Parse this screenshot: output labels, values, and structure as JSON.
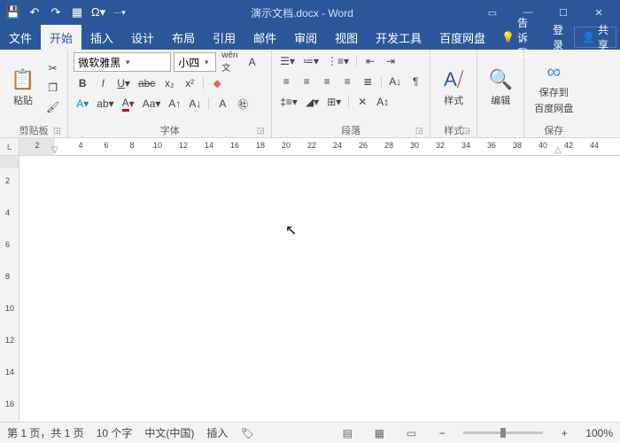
{
  "title": "演示文档.docx - Word",
  "tabs": {
    "file": "文件",
    "home": "开始",
    "insert": "插入",
    "design": "设计",
    "layout": "布局",
    "references": "引用",
    "mailings": "邮件",
    "review": "审阅",
    "view": "视图",
    "dev": "开发工具",
    "baidu": "百度网盘",
    "tell_me": "告诉我...",
    "login": "登录",
    "share": "共享"
  },
  "font": {
    "name": "微软雅黑",
    "size": "小四"
  },
  "groups": {
    "clipboard": "剪贴板",
    "paste": "粘贴",
    "font": "字体",
    "paragraph": "段落",
    "styles": "样式",
    "styles_btn": "样式",
    "edit": "编辑",
    "save": "保存",
    "save_to": "保存到",
    "save_to2": "百度网盘"
  },
  "ruler": {
    "ticks": [
      2,
      4,
      6,
      8,
      10,
      12,
      14,
      16,
      18,
      20,
      22,
      24,
      26,
      28,
      30,
      32,
      34,
      36,
      38,
      40,
      42,
      44
    ]
  },
  "status": {
    "page": "第 1 页，共 1 页",
    "words": "10 个字",
    "lang": "中文(中国)",
    "mode": "插入",
    "zoom": "100%"
  }
}
